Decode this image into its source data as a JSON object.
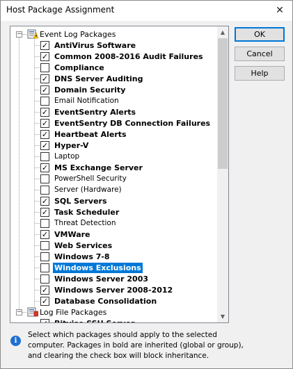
{
  "window": {
    "title": "Host Package Assignment",
    "close_glyph": "✕"
  },
  "tree": {
    "groups": [
      {
        "label": "Event Log Packages",
        "expander": "−",
        "icon": "event-log-packages-icon"
      },
      {
        "label": "Log File Packages",
        "expander": "−",
        "icon": "log-file-packages-icon"
      }
    ],
    "items": [
      {
        "label": "AntiVirus Software",
        "checked": true,
        "bold": true,
        "selected": false
      },
      {
        "label": "Common 2008-2016 Audit Failures",
        "checked": true,
        "bold": true,
        "selected": false
      },
      {
        "label": "Compliance",
        "checked": false,
        "bold": true,
        "selected": false
      },
      {
        "label": "DNS Server Auditing",
        "checked": true,
        "bold": true,
        "selected": false
      },
      {
        "label": "Domain Security",
        "checked": true,
        "bold": true,
        "selected": false
      },
      {
        "label": "Email Notification",
        "checked": false,
        "bold": false,
        "selected": false
      },
      {
        "label": "EventSentry Alerts",
        "checked": true,
        "bold": true,
        "selected": false
      },
      {
        "label": "EventSentry DB Connection Failures",
        "checked": true,
        "bold": true,
        "selected": false
      },
      {
        "label": "Heartbeat Alerts",
        "checked": true,
        "bold": true,
        "selected": false
      },
      {
        "label": "Hyper-V",
        "checked": true,
        "bold": true,
        "selected": false
      },
      {
        "label": "Laptop",
        "checked": false,
        "bold": false,
        "selected": false
      },
      {
        "label": "MS Exchange Server",
        "checked": true,
        "bold": true,
        "selected": false
      },
      {
        "label": "PowerShell Security",
        "checked": false,
        "bold": false,
        "selected": false
      },
      {
        "label": "Server (Hardware)",
        "checked": false,
        "bold": false,
        "selected": false
      },
      {
        "label": "SQL Servers",
        "checked": true,
        "bold": true,
        "selected": false
      },
      {
        "label": "Task Scheduler",
        "checked": true,
        "bold": true,
        "selected": false
      },
      {
        "label": "Threat Detection",
        "checked": false,
        "bold": false,
        "selected": false
      },
      {
        "label": "VMWare",
        "checked": true,
        "bold": true,
        "selected": false
      },
      {
        "label": "Web Services",
        "checked": false,
        "bold": true,
        "selected": false
      },
      {
        "label": "Windows 7-8",
        "checked": false,
        "bold": true,
        "selected": false
      },
      {
        "label": "Windows Exclusions",
        "checked": false,
        "bold": true,
        "selected": true
      },
      {
        "label": "Windows Server 2003",
        "checked": false,
        "bold": true,
        "selected": false
      },
      {
        "label": "Windows Server 2008-2012",
        "checked": true,
        "bold": true,
        "selected": false
      },
      {
        "label": "Database Consolidation",
        "checked": true,
        "bold": true,
        "selected": false
      }
    ],
    "partial_item": {
      "label": "Bitvise SSH Server",
      "checked": true,
      "bold": true
    }
  },
  "buttons": {
    "ok": "OK",
    "cancel": "Cancel",
    "help": "Help"
  },
  "info": {
    "icon": "info-icon",
    "lines": [
      "Select which packages should apply to the selected",
      "computer. Packages in bold are inherited (global or group),",
      "and clearing the check box will block inheritance."
    ]
  },
  "colors": {
    "selection": "#0078d7",
    "default_button_border": "#0078d7"
  }
}
